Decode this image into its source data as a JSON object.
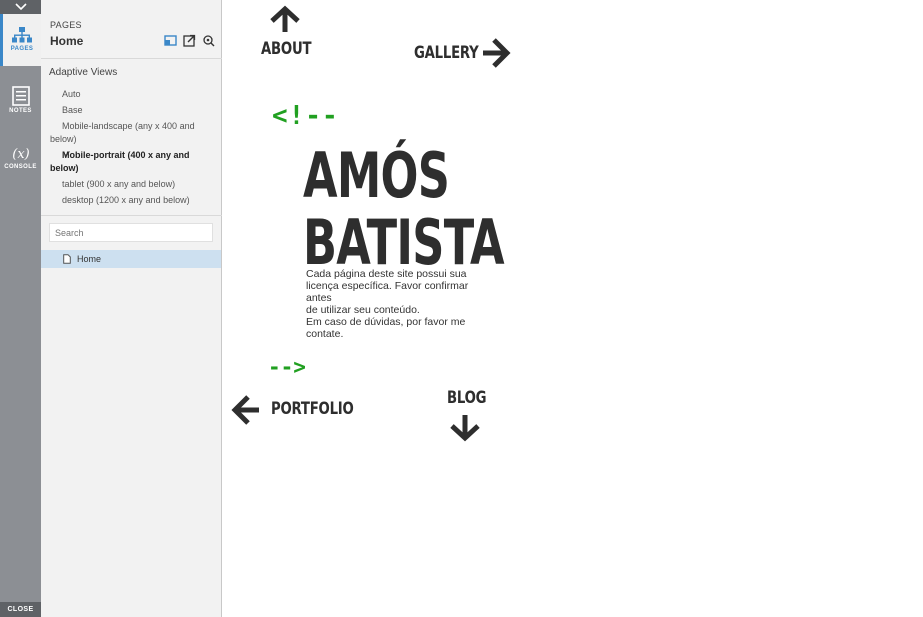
{
  "rail": {
    "items": [
      {
        "label": "PAGES",
        "icon": "sitemap-icon",
        "active": true
      },
      {
        "label": "NOTES",
        "icon": "notes-icon",
        "active": false
      },
      {
        "label": "CONSOLE",
        "icon": "variable-icon",
        "active": false
      }
    ],
    "close_label": "CLOSE"
  },
  "panel": {
    "section_label": "PAGES",
    "current_page": "Home",
    "adaptive_views_title": "Adaptive Views",
    "views": [
      {
        "label": "Auto"
      },
      {
        "label": "Base"
      },
      {
        "label": "Mobile-landscape (any x 400 and below)"
      },
      {
        "label": "Mobile-portrait (400 x any and below)",
        "selected": true
      },
      {
        "label": "tablet (900 x any and below)"
      },
      {
        "label": "desktop (1200 x any and below)"
      }
    ],
    "search_placeholder": "Search",
    "pages": [
      {
        "label": "Home",
        "selected": true
      }
    ]
  },
  "site": {
    "nav": {
      "about": "ABOUT",
      "gallery": "GALLERY",
      "portfolio": "PORTFOLIO",
      "blog": "BLOG"
    },
    "code_open": "<!--",
    "code_close": "-->",
    "hero_line1": "AMÓS",
    "hero_line2": "BATISTA",
    "description": "Cada página deste site possui sua licença específica. Favor confirmar antes\nde utilizar seu conteúdo.\nEm caso de dúvidas, por favor me contate."
  },
  "colors": {
    "accent": "#3a87c8",
    "code_green": "#21a021",
    "heading": "#2e2e2e",
    "triangle": "#b8e0b8"
  }
}
